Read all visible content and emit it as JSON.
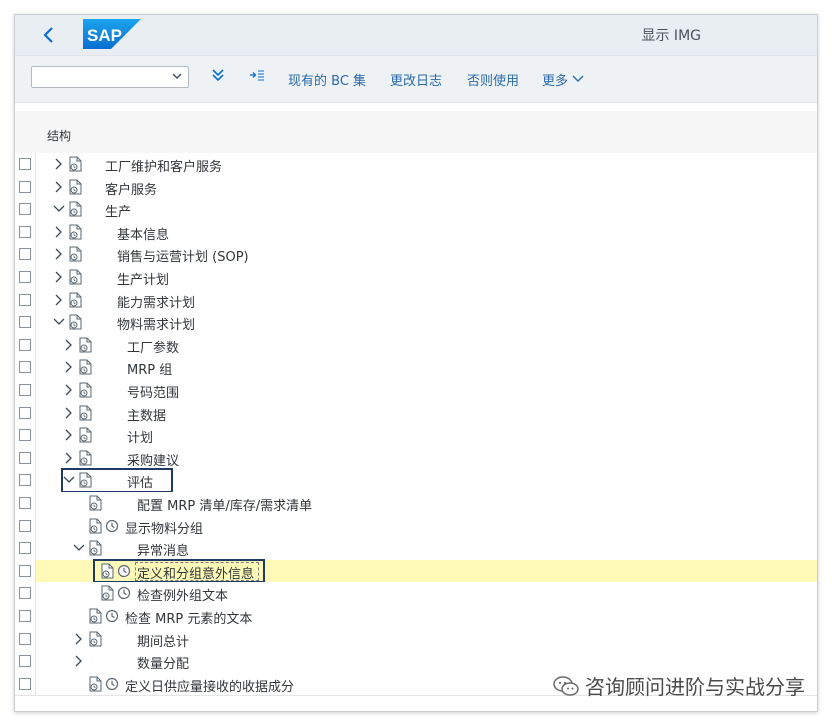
{
  "shell": {
    "title": "显示 IMG"
  },
  "toolbar": {
    "command_value": "",
    "buttons": [
      "现有的 BC 集",
      "更改日志",
      "否则使用",
      "更多"
    ]
  },
  "table": {
    "header": "结构"
  },
  "tree": [
    {
      "label": "工厂维护和客户服务",
      "level": 0,
      "toggle": "collapsed"
    },
    {
      "label": "客户服务",
      "level": 0,
      "toggle": "collapsed"
    },
    {
      "label": "生产",
      "level": 0,
      "toggle": "expanded"
    },
    {
      "label": "基本信息",
      "level": 1,
      "toggle": "collapsed"
    },
    {
      "label": "销售与运营计划 (SOP)",
      "level": 1,
      "toggle": "collapsed"
    },
    {
      "label": "生产计划",
      "level": 1,
      "toggle": "collapsed"
    },
    {
      "label": "能力需求计划",
      "level": 1,
      "toggle": "collapsed"
    },
    {
      "label": "物料需求计划",
      "level": 1,
      "toggle": "expanded"
    },
    {
      "label": "工厂参数",
      "level": 2,
      "toggle": "collapsed"
    },
    {
      "label": "MRP 组",
      "level": 2,
      "toggle": "collapsed"
    },
    {
      "label": "号码范围",
      "level": 2,
      "toggle": "collapsed"
    },
    {
      "label": "主数据",
      "level": 2,
      "toggle": "collapsed"
    },
    {
      "label": "计划",
      "level": 2,
      "toggle": "collapsed"
    },
    {
      "label": "采购建议",
      "level": 2,
      "toggle": "collapsed"
    },
    {
      "label": "评估",
      "level": 2,
      "toggle": "expanded",
      "boxed": true
    },
    {
      "label": "配置 MRP 清单/库存/需求清单",
      "level": 3,
      "toggle": "none"
    },
    {
      "label": "显示物料分组",
      "level": 3,
      "toggle": "none",
      "clock": true
    },
    {
      "label": "异常消息",
      "level": 3,
      "toggle": "expanded"
    },
    {
      "label": "定义和分组意外信息",
      "level": 4,
      "toggle": "none",
      "clock": true,
      "highlight": true,
      "boxed": true
    },
    {
      "label": "检查例外组文本",
      "level": 4,
      "toggle": "none",
      "clock": true
    },
    {
      "label": "检查 MRP 元素的文本",
      "level": 3,
      "toggle": "none",
      "clock": true
    },
    {
      "label": "期间总计",
      "level": 3,
      "toggle": "collapsed"
    },
    {
      "label": "数量分配",
      "level": 3,
      "toggle": "collapsed",
      "noicon": true
    },
    {
      "label": "定义日供应量接收的收据成分",
      "level": 3,
      "toggle": "none",
      "clock": true
    }
  ],
  "watermark": {
    "text": "咨询顾问进阶与实战分享"
  }
}
